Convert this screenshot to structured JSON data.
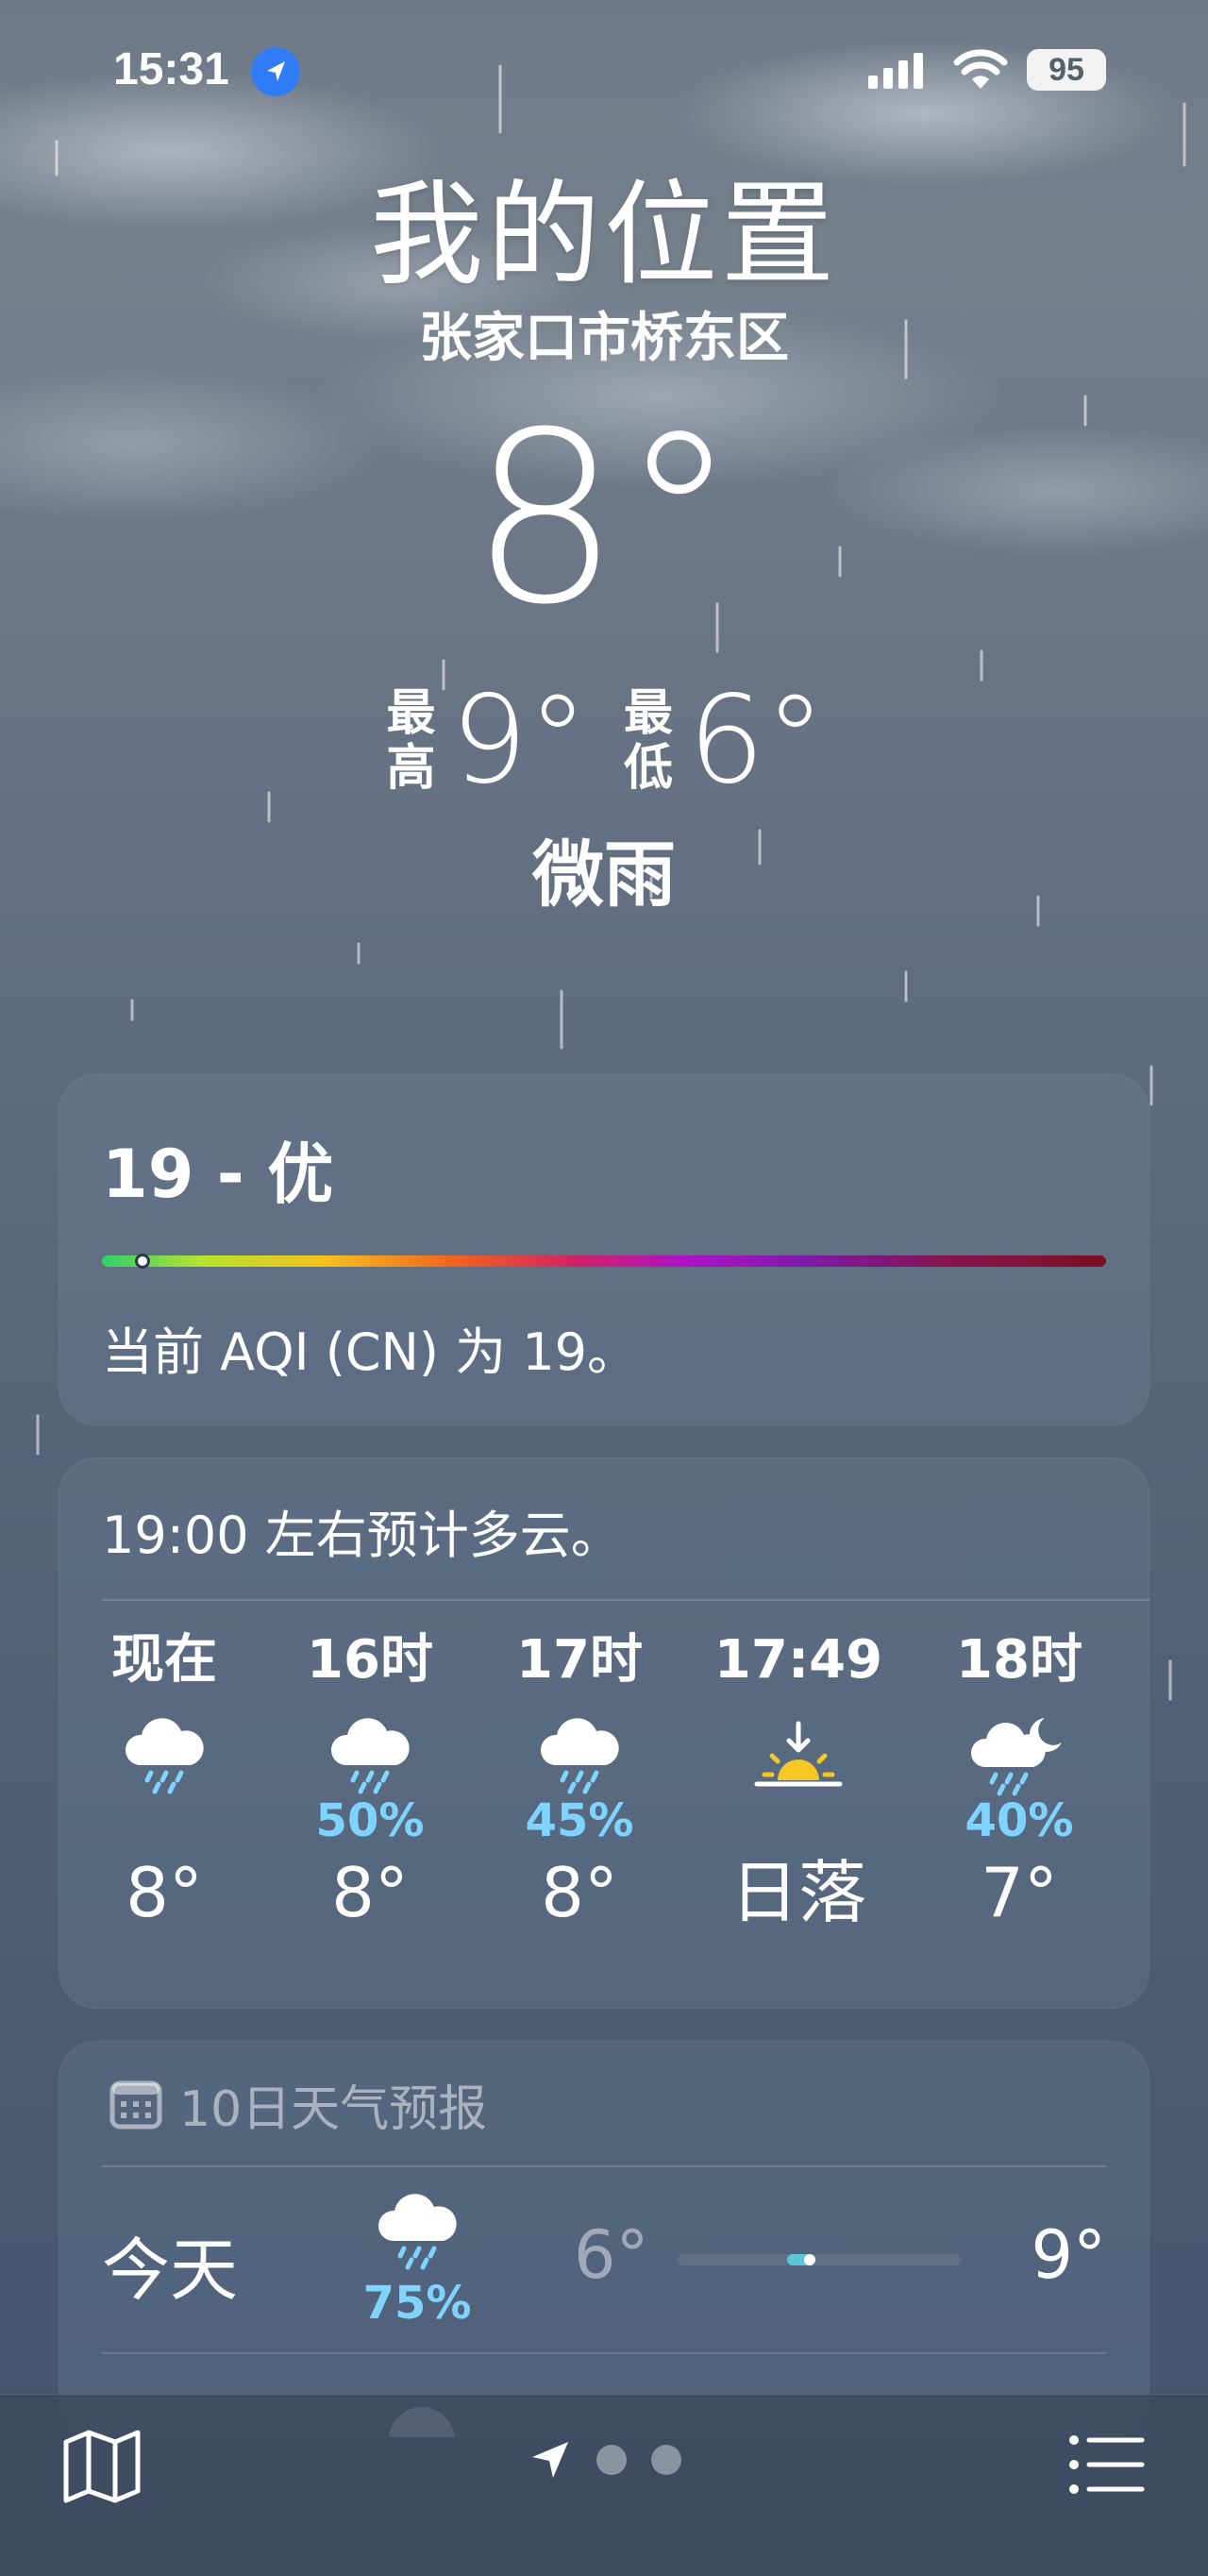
{
  "status_bar": {
    "time": "15:31",
    "battery": "95",
    "icons": [
      "location-arrow-icon",
      "cellular-signal-icon",
      "wifi-icon",
      "battery-icon"
    ]
  },
  "header": {
    "title": "我的位置",
    "subtitle": "张家口市桥东区",
    "temperature": "8°",
    "high_label": "最高",
    "high_value": "9°",
    "low_label": "最低",
    "low_value": "6°",
    "condition": "微雨"
  },
  "aqi": {
    "value_label": "19 - 优",
    "description": "当前 AQI (CN) 为 19。",
    "level_fraction": 0.04
  },
  "hourly": {
    "summary": "19:00 左右预计多云。",
    "items": [
      {
        "time": "现在",
        "icon": "cloud-rain-icon",
        "pop": "",
        "temp": "8°"
      },
      {
        "time": "16时",
        "icon": "cloud-rain-icon",
        "pop": "50%",
        "temp": "8°"
      },
      {
        "time": "17时",
        "icon": "cloud-rain-icon",
        "pop": "45%",
        "temp": "8°"
      },
      {
        "time": "17:49",
        "icon": "sunset-icon",
        "pop": "",
        "temp": "日落"
      },
      {
        "time": "18时",
        "icon": "moon-cloud-rain-icon",
        "pop": "40%",
        "temp": "7°"
      }
    ]
  },
  "daily": {
    "header": "10日天气预报",
    "rows": [
      {
        "day": "今天",
        "icon": "cloud-rain-icon",
        "pop": "75%",
        "low": "6°",
        "high": "9°"
      }
    ]
  },
  "colors": {
    "precip_blue": "#7fd3ff",
    "location_blue": "#2f7cf6",
    "sunset_yellow": "#f7c824"
  }
}
